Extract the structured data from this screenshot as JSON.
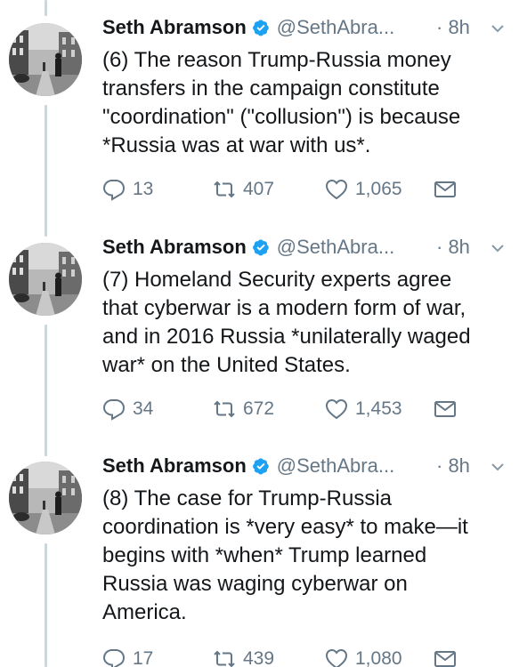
{
  "author": {
    "name": "Seth Abramson",
    "handle": "@SethAbra...",
    "time": "· 8h"
  },
  "tweets": [
    {
      "lines": [
        "(6) The reason Trump-Russia money",
        "transfers in the campaign constitute",
        "\"coordination\" (\"collusion\") is because",
        "*Russia was at war with us*."
      ],
      "replies": "13",
      "retweets": "407",
      "likes": "1,065"
    },
    {
      "lines": [
        "(7) Homeland Security experts agree",
        "that cyberwar is a modern form of war,",
        "and in 2016 Russia *unilaterally waged",
        "war* on the United States."
      ],
      "replies": "34",
      "retweets": "672",
      "likes": "1,453"
    },
    {
      "lines": [
        "(8) The case for Trump-Russia",
        "coordination is *very easy* to make—it",
        "begins with *when* Trump learned",
        "Russia was waging cyberwar on",
        "America."
      ],
      "replies": "17",
      "retweets": "439",
      "likes": "1,080"
    }
  ],
  "icons": {
    "reply": "reply-icon",
    "retweet": "retweet-icon",
    "like": "heart-icon",
    "dm": "envelope-icon",
    "verified": "verified-badge-icon",
    "menu": "chevron-down-icon"
  },
  "colors": {
    "text": "#14171a",
    "secondary": "#657786",
    "verified": "#1da1f2",
    "thread": "#ccd6dd"
  }
}
